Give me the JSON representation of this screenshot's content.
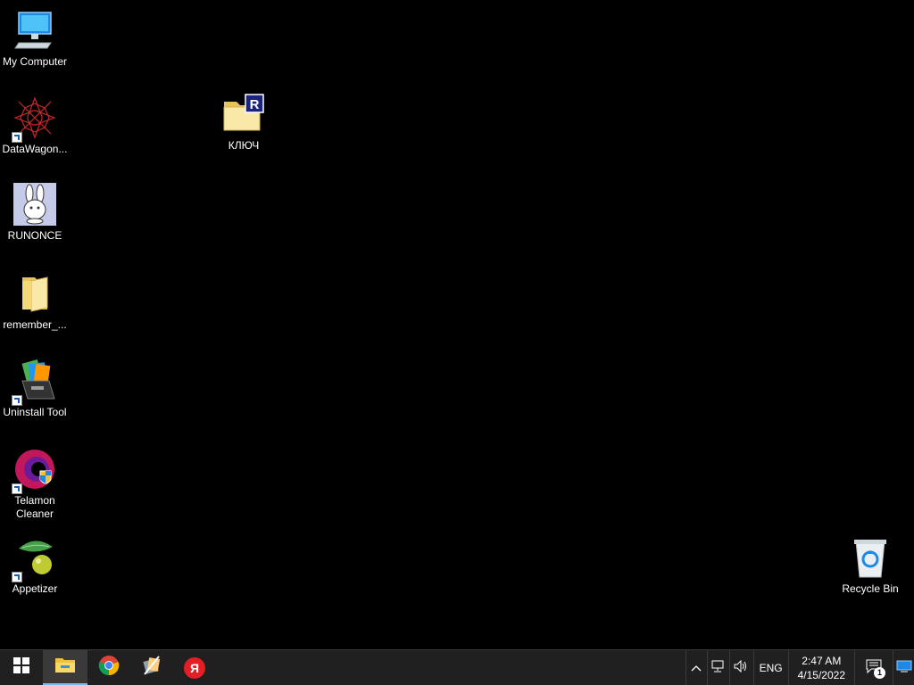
{
  "desktop_icons": [
    {
      "label": "My Computer",
      "icon": "computer-icon"
    },
    {
      "label": "DataWagon...",
      "icon": "datawagon-icon"
    },
    {
      "label": "RUNONCE",
      "icon": "bunny-icon"
    },
    {
      "label": "remember_...",
      "icon": "folder-icon"
    },
    {
      "label": "Uninstall Tool",
      "icon": "uninstall-tool-icon"
    },
    {
      "label": "Telamon Cleaner",
      "icon": "telamon-icon"
    },
    {
      "label": "Appetizer",
      "icon": "appetizer-icon"
    },
    {
      "label": "КЛЮЧ",
      "icon": "folder-r-icon"
    },
    {
      "label": "Recycle Bin",
      "icon": "recycle-bin-icon"
    }
  ],
  "taskbar": {
    "apps": [
      "start-icon",
      "file-explorer-icon",
      "chrome-icon",
      "app-icon",
      "yandex-icon"
    ],
    "yandex_letter": "Я",
    "tray": {
      "lang": "ENG",
      "time": "2:47 AM",
      "date": "4/15/2022",
      "notification_count": "1"
    }
  },
  "colors": {
    "taskbar": "#202020",
    "accent": "#76b9ed",
    "yandex": "#e31e24"
  }
}
